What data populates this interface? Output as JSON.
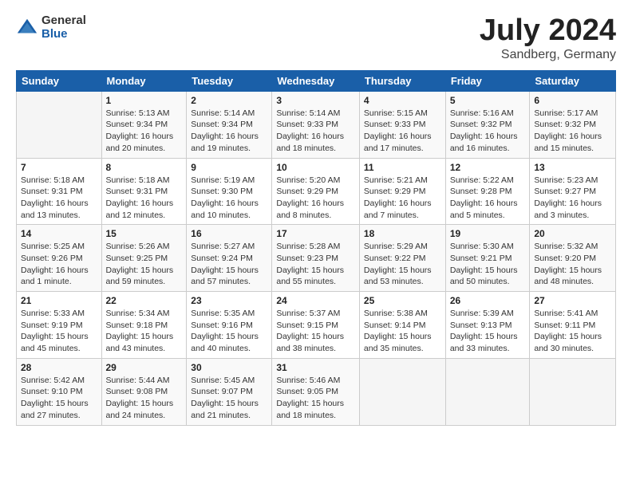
{
  "logo": {
    "general": "General",
    "blue": "Blue"
  },
  "title": "July 2024",
  "location": "Sandberg, Germany",
  "days_header": [
    "Sunday",
    "Monday",
    "Tuesday",
    "Wednesday",
    "Thursday",
    "Friday",
    "Saturday"
  ],
  "weeks": [
    [
      {
        "num": "",
        "info": ""
      },
      {
        "num": "1",
        "info": "Sunrise: 5:13 AM\nSunset: 9:34 PM\nDaylight: 16 hours\nand 20 minutes."
      },
      {
        "num": "2",
        "info": "Sunrise: 5:14 AM\nSunset: 9:34 PM\nDaylight: 16 hours\nand 19 minutes."
      },
      {
        "num": "3",
        "info": "Sunrise: 5:14 AM\nSunset: 9:33 PM\nDaylight: 16 hours\nand 18 minutes."
      },
      {
        "num": "4",
        "info": "Sunrise: 5:15 AM\nSunset: 9:33 PM\nDaylight: 16 hours\nand 17 minutes."
      },
      {
        "num": "5",
        "info": "Sunrise: 5:16 AM\nSunset: 9:32 PM\nDaylight: 16 hours\nand 16 minutes."
      },
      {
        "num": "6",
        "info": "Sunrise: 5:17 AM\nSunset: 9:32 PM\nDaylight: 16 hours\nand 15 minutes."
      }
    ],
    [
      {
        "num": "7",
        "info": "Sunrise: 5:18 AM\nSunset: 9:31 PM\nDaylight: 16 hours\nand 13 minutes."
      },
      {
        "num": "8",
        "info": "Sunrise: 5:18 AM\nSunset: 9:31 PM\nDaylight: 16 hours\nand 12 minutes."
      },
      {
        "num": "9",
        "info": "Sunrise: 5:19 AM\nSunset: 9:30 PM\nDaylight: 16 hours\nand 10 minutes."
      },
      {
        "num": "10",
        "info": "Sunrise: 5:20 AM\nSunset: 9:29 PM\nDaylight: 16 hours\nand 8 minutes."
      },
      {
        "num": "11",
        "info": "Sunrise: 5:21 AM\nSunset: 9:29 PM\nDaylight: 16 hours\nand 7 minutes."
      },
      {
        "num": "12",
        "info": "Sunrise: 5:22 AM\nSunset: 9:28 PM\nDaylight: 16 hours\nand 5 minutes."
      },
      {
        "num": "13",
        "info": "Sunrise: 5:23 AM\nSunset: 9:27 PM\nDaylight: 16 hours\nand 3 minutes."
      }
    ],
    [
      {
        "num": "14",
        "info": "Sunrise: 5:25 AM\nSunset: 9:26 PM\nDaylight: 16 hours\nand 1 minute."
      },
      {
        "num": "15",
        "info": "Sunrise: 5:26 AM\nSunset: 9:25 PM\nDaylight: 15 hours\nand 59 minutes."
      },
      {
        "num": "16",
        "info": "Sunrise: 5:27 AM\nSunset: 9:24 PM\nDaylight: 15 hours\nand 57 minutes."
      },
      {
        "num": "17",
        "info": "Sunrise: 5:28 AM\nSunset: 9:23 PM\nDaylight: 15 hours\nand 55 minutes."
      },
      {
        "num": "18",
        "info": "Sunrise: 5:29 AM\nSunset: 9:22 PM\nDaylight: 15 hours\nand 53 minutes."
      },
      {
        "num": "19",
        "info": "Sunrise: 5:30 AM\nSunset: 9:21 PM\nDaylight: 15 hours\nand 50 minutes."
      },
      {
        "num": "20",
        "info": "Sunrise: 5:32 AM\nSunset: 9:20 PM\nDaylight: 15 hours\nand 48 minutes."
      }
    ],
    [
      {
        "num": "21",
        "info": "Sunrise: 5:33 AM\nSunset: 9:19 PM\nDaylight: 15 hours\nand 45 minutes."
      },
      {
        "num": "22",
        "info": "Sunrise: 5:34 AM\nSunset: 9:18 PM\nDaylight: 15 hours\nand 43 minutes."
      },
      {
        "num": "23",
        "info": "Sunrise: 5:35 AM\nSunset: 9:16 PM\nDaylight: 15 hours\nand 40 minutes."
      },
      {
        "num": "24",
        "info": "Sunrise: 5:37 AM\nSunset: 9:15 PM\nDaylight: 15 hours\nand 38 minutes."
      },
      {
        "num": "25",
        "info": "Sunrise: 5:38 AM\nSunset: 9:14 PM\nDaylight: 15 hours\nand 35 minutes."
      },
      {
        "num": "26",
        "info": "Sunrise: 5:39 AM\nSunset: 9:13 PM\nDaylight: 15 hours\nand 33 minutes."
      },
      {
        "num": "27",
        "info": "Sunrise: 5:41 AM\nSunset: 9:11 PM\nDaylight: 15 hours\nand 30 minutes."
      }
    ],
    [
      {
        "num": "28",
        "info": "Sunrise: 5:42 AM\nSunset: 9:10 PM\nDaylight: 15 hours\nand 27 minutes."
      },
      {
        "num": "29",
        "info": "Sunrise: 5:44 AM\nSunset: 9:08 PM\nDaylight: 15 hours\nand 24 minutes."
      },
      {
        "num": "30",
        "info": "Sunrise: 5:45 AM\nSunset: 9:07 PM\nDaylight: 15 hours\nand 21 minutes."
      },
      {
        "num": "31",
        "info": "Sunrise: 5:46 AM\nSunset: 9:05 PM\nDaylight: 15 hours\nand 18 minutes."
      },
      {
        "num": "",
        "info": ""
      },
      {
        "num": "",
        "info": ""
      },
      {
        "num": "",
        "info": ""
      }
    ]
  ]
}
